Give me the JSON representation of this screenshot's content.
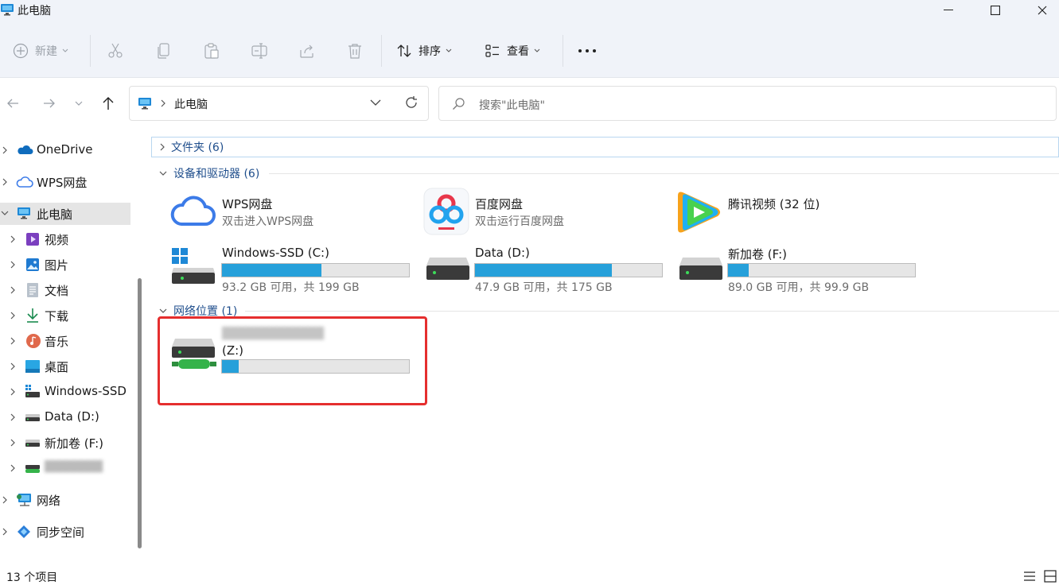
{
  "window": {
    "title": "此电脑"
  },
  "toolbar": {
    "new_label": "新建",
    "sort_label": "排序",
    "view_label": "查看",
    "more_label": "···"
  },
  "address": {
    "location": "此电脑"
  },
  "search": {
    "placeholder": "搜索\"此电脑\""
  },
  "sidebar": {
    "items": [
      {
        "label": "OneDrive"
      },
      {
        "label": "WPS网盘"
      },
      {
        "label": "此电脑"
      },
      {
        "label": "视频"
      },
      {
        "label": "图片"
      },
      {
        "label": "文档"
      },
      {
        "label": "下载"
      },
      {
        "label": "音乐"
      },
      {
        "label": "桌面"
      },
      {
        "label": "Windows-SSD ("
      },
      {
        "label": "Data (D:)"
      },
      {
        "label": "新加卷 (F:)"
      },
      {
        "label": "████████"
      },
      {
        "label": "网络"
      },
      {
        "label": "同步空间"
      }
    ]
  },
  "groups": {
    "folders": "文件夹 (6)",
    "devices": "设备和驱动器 (6)",
    "network": "网络位置 (1)"
  },
  "devices": {
    "wps": {
      "name": "WPS网盘",
      "sub": "双击进入WPS网盘"
    },
    "baidu": {
      "name": "百度网盘",
      "sub": "双击运行百度网盘"
    },
    "tencent": {
      "name": "腾讯视频 (32 位)"
    },
    "c": {
      "name": "Windows-SSD (C:)",
      "sub": "93.2 GB 可用，共 199 GB",
      "used_fraction": 0.53
    },
    "d": {
      "name": "Data (D:)",
      "sub": "47.9 GB 可用，共 175 GB",
      "used_fraction": 0.73
    },
    "f": {
      "name": "新加卷 (F:)",
      "sub": "89.0 GB 可用，共 99.9 GB",
      "used_fraction": 0.11
    }
  },
  "network": {
    "z": {
      "name_blurred": "█████████████",
      "letter": "(Z:)",
      "used_fraction": 0.09
    }
  },
  "status": {
    "count": "13 个项目"
  },
  "colors": {
    "accent": "#26a0da",
    "highlight": "#e52e2e",
    "group_text": "#1f4e8c"
  }
}
